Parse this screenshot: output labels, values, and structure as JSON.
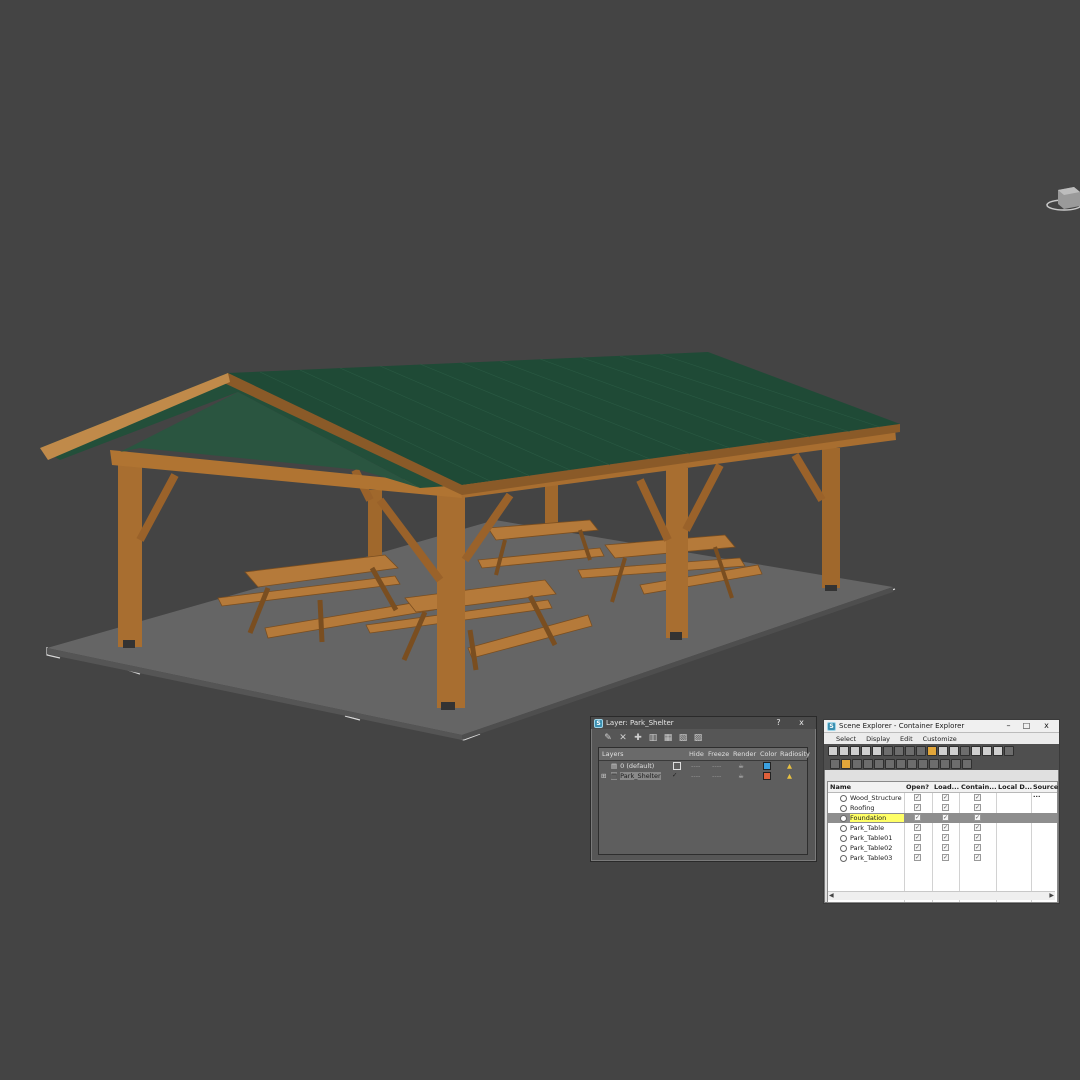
{
  "layer_dialog": {
    "title": "Layer: Park_Shelter",
    "help_glyph": "?",
    "close_glyph": "x",
    "columns": [
      "Layers",
      "Hide",
      "Freeze",
      "Render",
      "Color",
      "Radiosity"
    ],
    "rows": [
      {
        "name": "0 (default)",
        "color": "#3aa0e0"
      },
      {
        "name": "Park_Shelter",
        "color": "#e0603a"
      }
    ],
    "dash": "----"
  },
  "scene_explorer": {
    "title": "Scene Explorer - Container Explorer",
    "close_glyph": "x",
    "menu": [
      "Select",
      "Display",
      "Edit",
      "Customize"
    ],
    "columns": [
      "Name",
      "Open?",
      "Load...",
      "Contain...",
      "Local D...",
      "Source ..."
    ],
    "rows": [
      "Wood_Structure",
      "Roofing",
      "Foundation",
      "Park_Table",
      "Park_Table01",
      "Park_Table02",
      "Park_Table03"
    ],
    "selected_row": "Foundation"
  }
}
